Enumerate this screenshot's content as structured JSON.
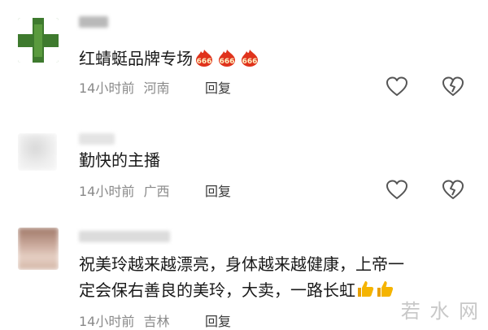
{
  "comments": [
    {
      "text": "红蜻蜓品牌专场",
      "emojis": [
        "fire-666-icon",
        "fire-666-icon",
        "fire-666-icon"
      ],
      "time": "14小时前",
      "location": "河南",
      "reply_label": "回复"
    },
    {
      "text": "勤快的主播",
      "emojis": [],
      "time": "14小时前",
      "location": "广西",
      "reply_label": "回复"
    },
    {
      "text_line1": "祝美玲越来越漂亮，身体越来越健康，上帝一",
      "text_line2": "定会保右善良的美玲，大卖，一路长虹",
      "emojis": [
        "thumbs-up-icon",
        "thumbs-up-icon"
      ],
      "time": "14小时前",
      "location": "吉林",
      "reply_label": "回复"
    }
  ],
  "watermark": "若 水 网",
  "colors": {
    "text": "#1a1a1a",
    "meta": "#8a8a8a",
    "fire": "#e0331c",
    "thumb": "#f5b400"
  }
}
